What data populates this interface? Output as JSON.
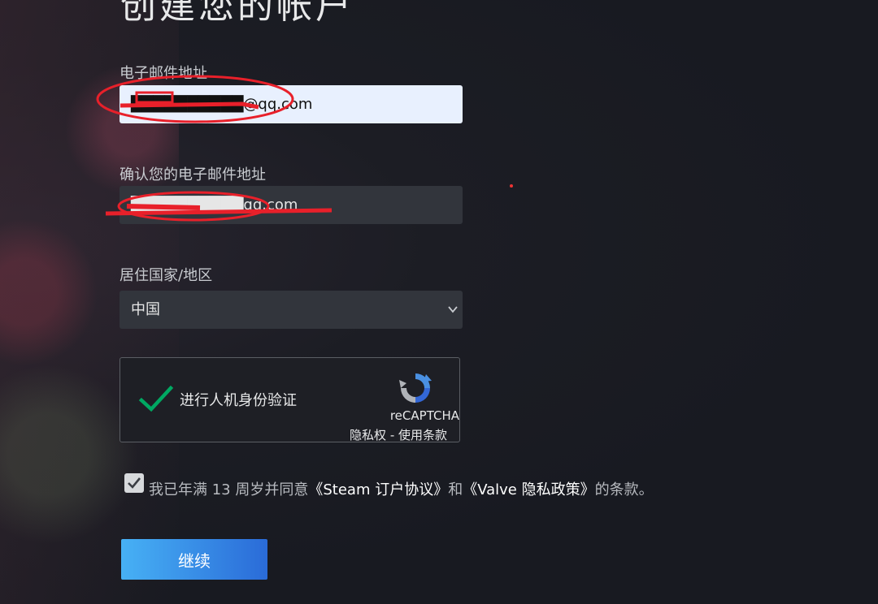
{
  "page": {
    "title": "创建您的帐户"
  },
  "form": {
    "email_label": "电子邮件地址",
    "email_value": "██████████@qq.com",
    "confirm_label": "确认您的电子邮件地址",
    "confirm_value": "██████████qq.com",
    "country_label": "居住国家/地区",
    "country_value": "中国"
  },
  "captcha": {
    "prompt": "进行人机身份验证",
    "brand": "reCAPTCHA",
    "links": "隐私权 - 使用条款",
    "check_icon": "checkmark-icon",
    "logo_icon": "recaptcha-logo-icon"
  },
  "agreement": {
    "prefix": "我已年满 13 周岁并同意",
    "ssa": "《Steam 订户协议》",
    "middle": "和",
    "privacy": "《Valve 隐私政策》",
    "suffix": "的条款。",
    "checked": true
  },
  "actions": {
    "continue_label": "继续"
  },
  "colors": {
    "accent_start": "#47b1f5",
    "accent_end": "#2a6bd8",
    "check_green": "#00a862",
    "annotation_red": "#e8202a"
  }
}
